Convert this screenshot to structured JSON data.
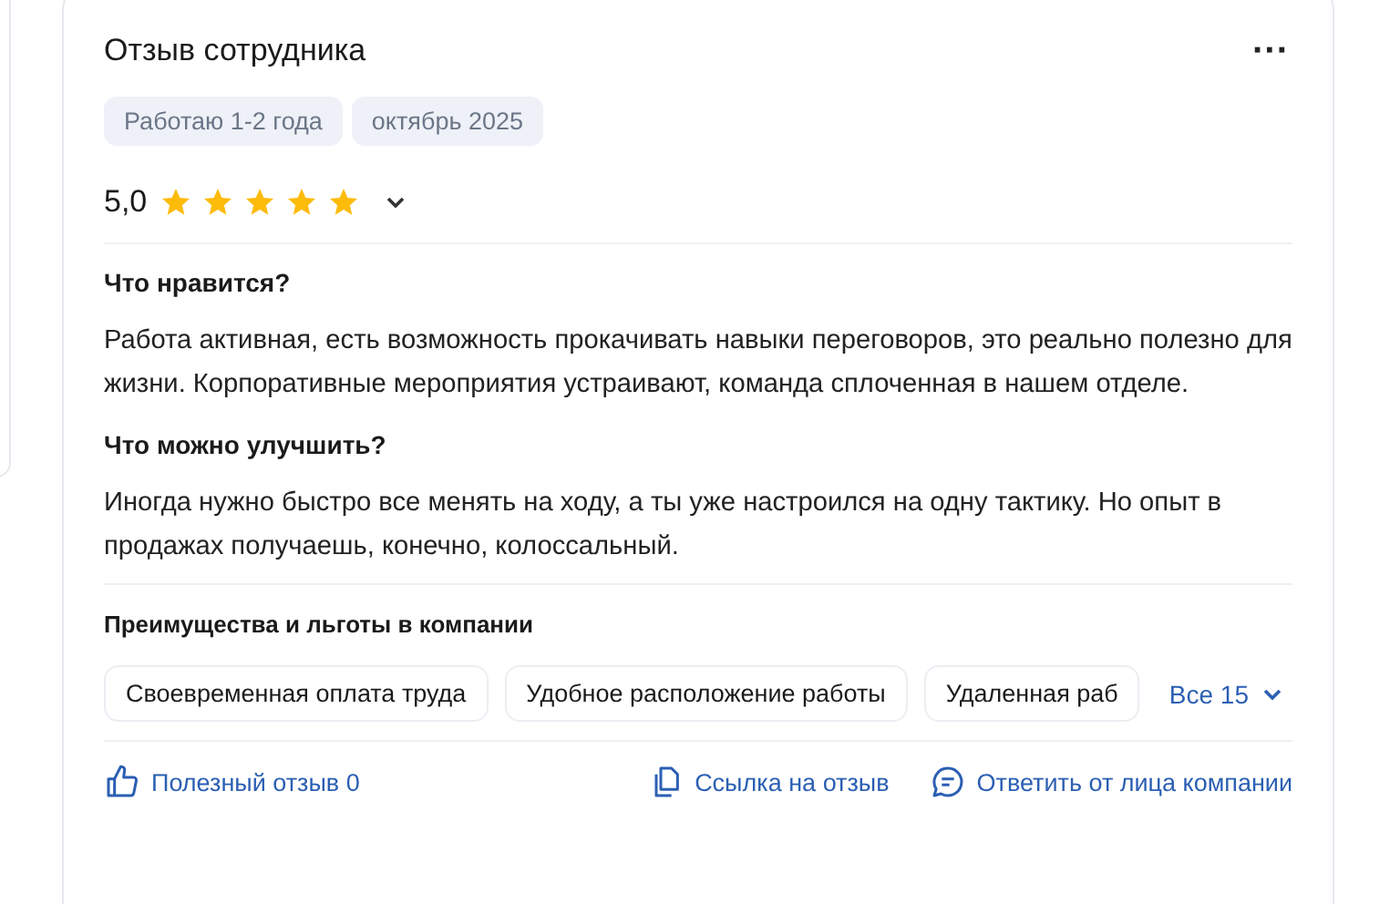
{
  "review": {
    "title": "Отзыв сотрудника",
    "menu_icon": "···",
    "tags": [
      "Работаю 1-2 года",
      "октябрь 2025"
    ],
    "rating": {
      "value": "5,0",
      "stars": 5
    },
    "sections": [
      {
        "heading": "Что нравится?",
        "text": "Работа активная, есть возможность прокачивать навыки переговоров, это реально полезно для жизни. Корпоративные мероприятия устраивают, команда сплоченная в нашем отделе."
      },
      {
        "heading": "Что можно улучшить?",
        "text": "Иногда нужно быстро все менять на ходу, а ты уже настроился на одну тактику. Но опыт в продажах получаешь, конечно, колоссальный."
      }
    ],
    "benefits": {
      "heading": "Преимущества и льготы в компании",
      "items": [
        "Своевременная оплата труда",
        "Удобное расположение работы",
        "Удаленная раб"
      ],
      "more": "Все 15"
    },
    "actions": [
      {
        "kind": "like",
        "label": "Полезный отзыв 0"
      },
      {
        "kind": "link",
        "label": "Ссылка на отзыв"
      },
      {
        "kind": "reply",
        "label": "Ответить от лица компании"
      }
    ]
  }
}
